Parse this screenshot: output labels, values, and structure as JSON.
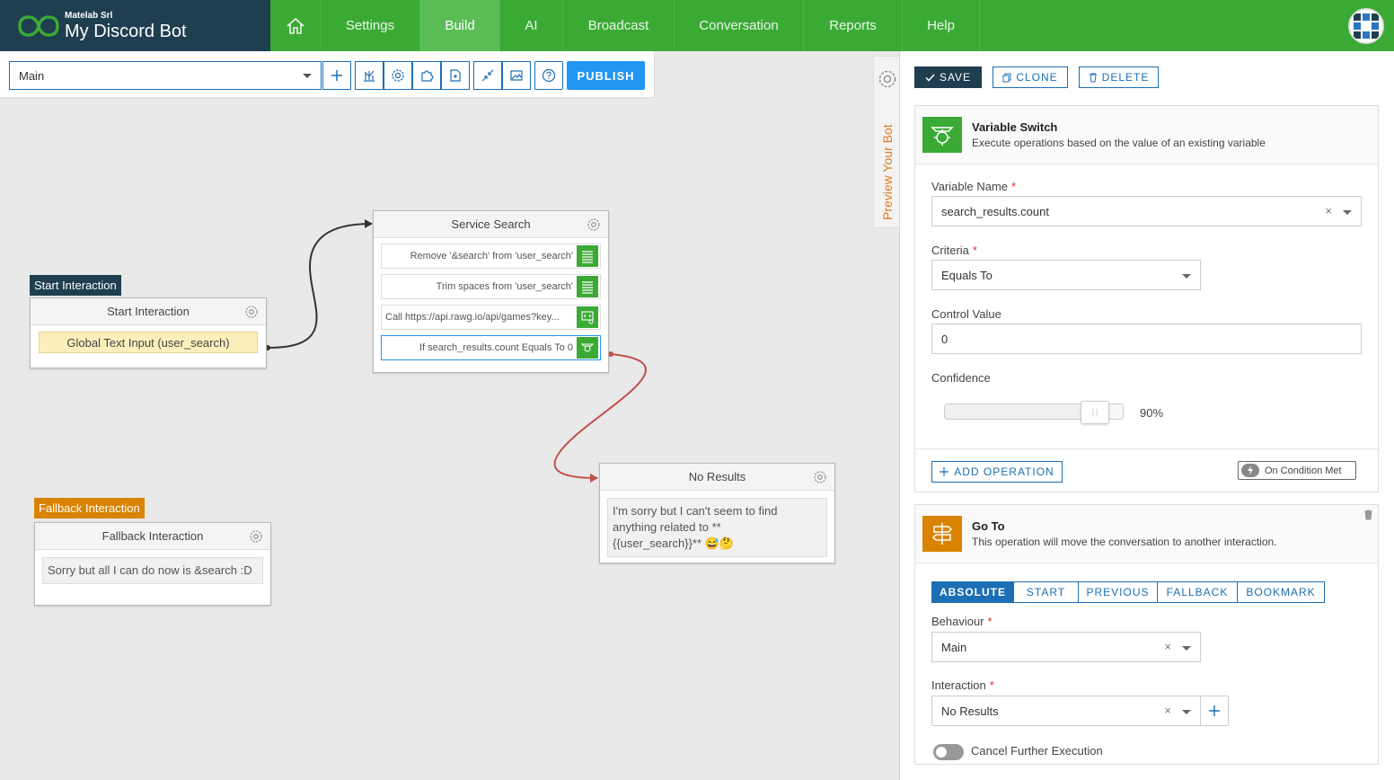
{
  "header": {
    "company": "Matelab Srl",
    "bot_name": "My Discord Bot",
    "nav": [
      {
        "label": "Settings",
        "active": false
      },
      {
        "label": "Build",
        "active": true
      },
      {
        "label": "AI",
        "active": false
      },
      {
        "label": "Broadcast",
        "active": false
      },
      {
        "label": "Conversation",
        "active": false
      },
      {
        "label": "Reports",
        "active": false
      },
      {
        "label": "Help",
        "active": false
      }
    ],
    "brand_color": "#1f3e4f",
    "nav_color": "#3aaa35"
  },
  "toolbar": {
    "behaviour_value": "Main",
    "publish_label": "PUBLISH",
    "icons": [
      "plus-icon",
      "chart-icon",
      "gear-icon",
      "puzzle-icon",
      "export-icon",
      "collapse-icon",
      "image-icon",
      "help-icon"
    ]
  },
  "canvas": {
    "start_node": {
      "tag": "Start Interaction",
      "title": "Start Interaction",
      "trigger": "Global Text Input (user_search)"
    },
    "service_node": {
      "title": "Service Search",
      "ops": [
        {
          "text": "Remove '&search' from 'user_search'",
          "icon": "list-icon"
        },
        {
          "text": "Trim spaces from 'user_search'",
          "icon": "list-icon"
        },
        {
          "text": "Call https://api.rawg.io/api/games?key...",
          "icon": "code-icon"
        },
        {
          "text": "If search_results.count Equals To 0",
          "icon": "switch-icon"
        }
      ]
    },
    "noresults_node": {
      "title": "No Results",
      "text_line1": "I'm sorry but I can't seem to find",
      "text_line2": "anything related to **",
      "text_line3": "{{user_search}}**",
      "emojis": "😅🤔"
    },
    "fallback_node": {
      "tag": "Fallback Interaction",
      "title": "Fallback Interaction",
      "text": "Sorry but all I can do now is &search :D"
    }
  },
  "preview": {
    "label": "Preview Your Bot"
  },
  "panel": {
    "actions": {
      "save": "SAVE",
      "clone": "CLONE",
      "delete": "DELETE"
    },
    "variable_switch": {
      "title": "Variable Switch",
      "subtitle": "Execute operations based on the value of an existing variable",
      "variable_name_label": "Variable Name",
      "variable_name_value": "search_results.count",
      "criteria_label": "Criteria",
      "criteria_value": "Equals To",
      "control_value_label": "Control Value",
      "control_value": "0",
      "confidence_label": "Confidence",
      "confidence_value": 0.9,
      "confidence_text": "90%",
      "add_operation": "ADD OPERATION",
      "condition_badge": "On Condition Met"
    },
    "goto": {
      "title": "Go To",
      "subtitle": "This operation will move the conversation to another interaction.",
      "tabs": [
        {
          "label": "ABSOLUTE",
          "active": true
        },
        {
          "label": "START",
          "active": false
        },
        {
          "label": "PREVIOUS",
          "active": false
        },
        {
          "label": "FALLBACK",
          "active": false
        },
        {
          "label": "BOOKMARK",
          "active": false
        }
      ],
      "behaviour_label": "Behaviour",
      "behaviour_value": "Main",
      "interaction_label": "Interaction",
      "interaction_value": "No Results",
      "cancel_label": "Cancel Further Execution",
      "cancel_enabled": false
    }
  }
}
